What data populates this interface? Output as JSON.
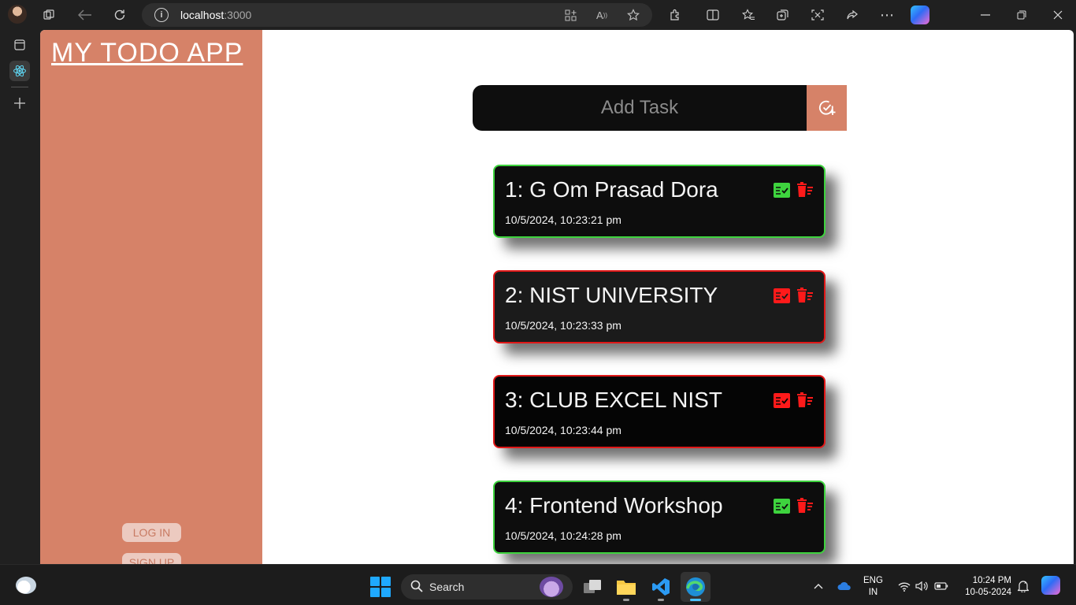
{
  "browser": {
    "url_host": "localhost",
    "url_port": ":3000"
  },
  "app": {
    "title": "MY TODO APP",
    "login_label": "LOG IN",
    "signup_label": "SIGN UP",
    "add_task_placeholder": "Add Task",
    "tasks": [
      {
        "name": "1: G Om Prasad Dora",
        "time": "10/5/2024, 10:23:21 pm",
        "status": "completed",
        "border_color": "#3ed33e"
      },
      {
        "name": "2: NIST UNIVERSITY",
        "time": "10/5/2024, 10:23:33 pm",
        "status": "pending",
        "border_color": "#e01818"
      },
      {
        "name": "3: CLUB EXCEL NIST",
        "time": "10/5/2024, 10:23:44 pm",
        "status": "pending",
        "border_color": "#e01818"
      },
      {
        "name": "4: Frontend Workshop",
        "time": "10/5/2024, 10:24:28 pm",
        "status": "completed",
        "border_color": "#3ed33e"
      }
    ],
    "colors": {
      "sidebar": "#d68268",
      "done": "#3ed33e",
      "pending": "#e01818",
      "delete": "#ff1a1a"
    }
  },
  "taskbar": {
    "search_label": "Search",
    "lang_line1": "ENG",
    "lang_line2": "IN",
    "time": "10:24 PM",
    "date": "10-05-2024"
  }
}
